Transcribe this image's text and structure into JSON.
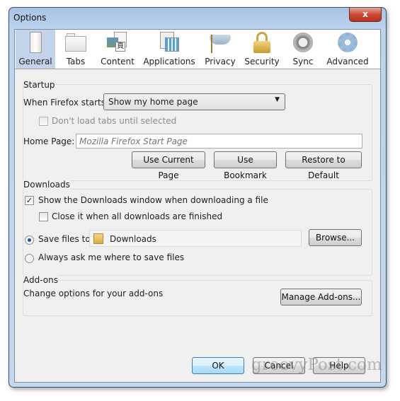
{
  "window": {
    "title": "Options",
    "close_glyph": "x"
  },
  "toolbar": {
    "items": [
      {
        "label": "General",
        "icon": "light-switch-icon",
        "selected": true
      },
      {
        "label": "Tabs",
        "icon": "folder-tabs-icon"
      },
      {
        "label": "Content",
        "icon": "content-icon"
      },
      {
        "label": "Applications",
        "icon": "applications-icon"
      },
      {
        "label": "Privacy",
        "icon": "mask-icon"
      },
      {
        "label": "Security",
        "icon": "padlock-icon"
      },
      {
        "label": "Sync",
        "icon": "sync-icon"
      },
      {
        "label": "Advanced",
        "icon": "gear-icon"
      }
    ]
  },
  "startup": {
    "title": "Startup",
    "when_label": "When Firefox starts:",
    "when_value": "Show my home page",
    "dont_load": "Don't load tabs until selected",
    "home_label": "Home Page:",
    "home_placeholder": "Mozilla Firefox Start Page",
    "use_current": "Use Current Page",
    "use_bookmark": "Use Bookmark",
    "restore": "Restore to Default"
  },
  "downloads": {
    "title": "Downloads",
    "show_window": "Show the Downloads window when downloading a file",
    "show_window_checked": true,
    "close_it": "Close it when all downloads are finished",
    "close_it_checked": false,
    "save_to": "Save files to",
    "save_folder": "Downloads",
    "browse": "Browse...",
    "always_ask": "Always ask me where to save files",
    "selected": "save_to"
  },
  "addons": {
    "title": "Add-ons",
    "desc": "Change options for your add-ons",
    "manage": "Manage Add-ons..."
  },
  "footer": {
    "ok": "OK",
    "cancel": "Cancel",
    "help": "Help"
  },
  "watermark": "groovyPost.com"
}
